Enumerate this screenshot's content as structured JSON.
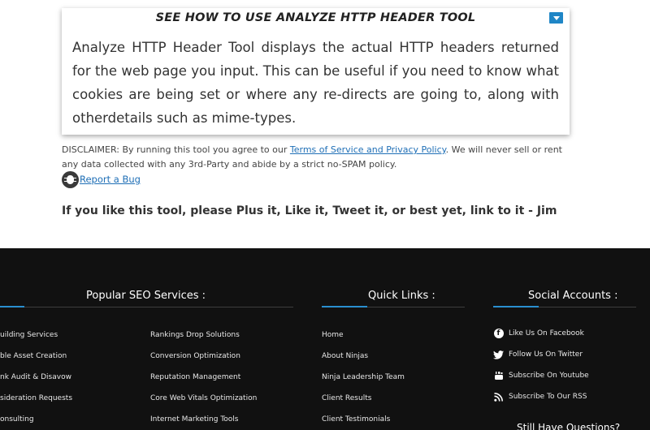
{
  "card": {
    "title": "SEE HOW TO USE ANALYZE HTTP HEADER TOOL",
    "body": "Analyze HTTP Header Tool displays the actual HTTP headers returned for the web page you input. This can be useful if you need to know what cookies are being set or where any re-directs are going to, along with otherdetails such as mime-types."
  },
  "disclaimer": {
    "prefix": "DISCLAIMER: By running this tool you agree to our ",
    "link": "Terms of Service and Privacy Policy",
    "suffix": ". We will never sell or rent any data collected with any 3rd-Party and abide by a strict no-SPAM policy."
  },
  "bug_link": "Report a Bug",
  "plea": "If you like this tool, please Plus it, Like it, Tweet it, or best yet, link to it - Jim",
  "footer": {
    "popular_title": "Popular SEO Services :",
    "quick_title": "Quick Links :",
    "social_title": "Social Accounts :",
    "popular_col1": [
      "uilding Services",
      "ble Asset Creation",
      "nk Audit & Disavow",
      "sideration Requests",
      "onsulting"
    ],
    "popular_col2": [
      "Rankings Drop Solutions",
      "Conversion Optimization",
      "Reputation Management",
      "Core Web Vitals Optimization",
      "Internet Marketing Tools"
    ],
    "quick_links": [
      "Home",
      "About Ninjas",
      "Ninja Leadership Team",
      "Client Results",
      "Client Testimonials"
    ],
    "social": [
      {
        "icon": "facebook-icon",
        "label": "Like Us On Facebook"
      },
      {
        "icon": "twitter-icon",
        "label": "Follow Us On Twitter"
      },
      {
        "icon": "youtube-icon",
        "label": "Subscribe On Youtube"
      },
      {
        "icon": "rss-icon",
        "label": "Subscribe To Our RSS"
      }
    ],
    "still": "Still Have Questions?"
  },
  "colors": {
    "accent": "#2a8fd0",
    "footer_bg": "#111111",
    "link": "#1f6fb6"
  }
}
